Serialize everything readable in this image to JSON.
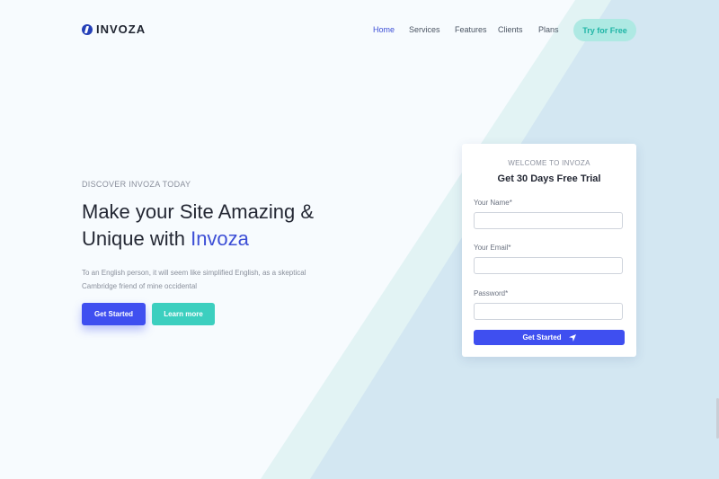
{
  "brand": {
    "name": "INVOZA"
  },
  "nav": {
    "items": [
      {
        "label": "Home",
        "active": true
      },
      {
        "label": "Services",
        "active": false
      },
      {
        "label": "Features",
        "active": false
      },
      {
        "label": "Clients",
        "active": false
      },
      {
        "label": "Plans",
        "active": false
      }
    ],
    "cta_label": "Try for Free"
  },
  "hero": {
    "eyebrow": "DISCOVER INVOZA TODAY",
    "headline_line1": "Make your Site Amazing &",
    "headline_line2_prefix": "Unique with ",
    "headline_accent": "Invoza",
    "description": "To an English person, it will seem like simplified English, as a skeptical Cambridge friend of mine occidental",
    "primary_button": "Get Started",
    "secondary_button": "Learn more"
  },
  "signup_card": {
    "eyebrow": "WELCOME TO INVOZA",
    "title": "Get 30 Days Free Trial",
    "name_label": "Your Name*",
    "email_label": "Your Email*",
    "password_label": "Password*",
    "name_value": "",
    "email_value": "",
    "password_value": "",
    "submit_label": "Get Started",
    "submit_icon": "send-icon"
  },
  "colors": {
    "accent_blue": "#3f4ff0",
    "accent_teal": "#3ccfbf",
    "background": "#f7fbfe",
    "diagonal_light": "#e3f3f6",
    "diagonal_blue": "#d5e8f3"
  }
}
